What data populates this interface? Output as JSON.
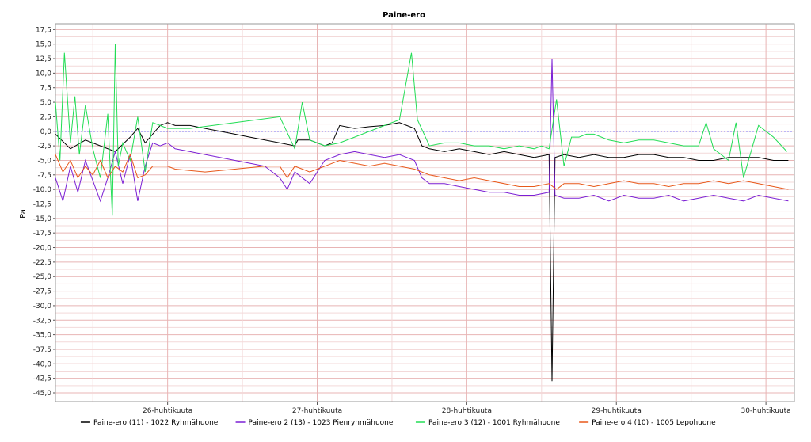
{
  "chart_data": {
    "type": "line",
    "title": "Paine-ero",
    "ylabel": "Pa",
    "xlabel": "",
    "ylim": [
      -46.5,
      18.5
    ],
    "xlim": [
      0,
      4.94
    ],
    "y_ticks": [
      "17,5",
      "15,0",
      "12,5",
      "10,0",
      "7,5",
      "5,0",
      "2,5",
      "0,0",
      "-2,5",
      "-5,0",
      "-7,5",
      "-10,0",
      "-12,5",
      "-15,0",
      "-17,5",
      "-20,0",
      "-22,5",
      "-25,0",
      "-27,5",
      "-30,0",
      "-32,5",
      "-35,0",
      "-37,5",
      "-40,0",
      "-42,5",
      "-45,0"
    ],
    "x_ticks": [
      "26-huhtikuuta",
      "27-huhtikuuta",
      "28-huhtikuuta",
      "29-huhtikuuta",
      "30-huhtikuuta"
    ],
    "reference_line": 0,
    "grid": true,
    "legend_position": "bottom",
    "colors": {
      "plot_border": "#999999",
      "grid_major": "#e8b4b4",
      "grid_minor": "#f3d9d9",
      "reference": "#0000ff"
    },
    "series": [
      {
        "name": "Paine-ero (11) - 1022 Ryhmähuone",
        "color": "#000000",
        "x": [
          0.0,
          0.1,
          0.2,
          0.3,
          0.4,
          0.5,
          0.55,
          0.6,
          0.7,
          0.75,
          0.8,
          0.9,
          1.0,
          1.1,
          1.2,
          1.3,
          1.4,
          1.5,
          1.6,
          1.62,
          1.7,
          1.8,
          1.85,
          1.9,
          2.0,
          2.1,
          2.2,
          2.3,
          2.4,
          2.45,
          2.5,
          2.6,
          2.7,
          2.8,
          2.9,
          3.0,
          3.1,
          3.2,
          3.3,
          3.32,
          3.33,
          3.34,
          3.4,
          3.5,
          3.6,
          3.7,
          3.8,
          3.9,
          4.0,
          4.1,
          4.2,
          4.3,
          4.4,
          4.5,
          4.6,
          4.7,
          4.8,
          4.9
        ],
        "y": [
          -0.5,
          -3.0,
          -1.5,
          -2.5,
          -3.5,
          -1.0,
          0.5,
          -2.0,
          1.0,
          1.5,
          1.0,
          1.0,
          0.5,
          0.0,
          -0.5,
          -1.0,
          -1.5,
          -2.0,
          -2.5,
          -1.5,
          -1.5,
          -2.5,
          -2.0,
          1.0,
          0.5,
          0.8,
          1.0,
          1.5,
          0.5,
          -2.5,
          -3.0,
          -3.5,
          -3.0,
          -3.5,
          -4.0,
          -3.5,
          -4.0,
          -4.5,
          -4.0,
          -43.0,
          -23.5,
          -4.5,
          -4.0,
          -4.5,
          -4.0,
          -4.5,
          -4.5,
          -4.0,
          -4.0,
          -4.5,
          -4.5,
          -5.0,
          -5.0,
          -4.5,
          -4.5,
          -4.5,
          -5.0,
          -5.0
        ]
      },
      {
        "name": "Paine-ero 2 (13) - 1023 Pienryhmähuone",
        "color": "#7b1fd4",
        "x": [
          0.0,
          0.05,
          0.1,
          0.15,
          0.2,
          0.3,
          0.35,
          0.4,
          0.45,
          0.5,
          0.55,
          0.6,
          0.65,
          0.7,
          0.75,
          0.8,
          0.9,
          1.0,
          1.1,
          1.2,
          1.3,
          1.4,
          1.5,
          1.55,
          1.6,
          1.7,
          1.8,
          1.9,
          2.0,
          2.1,
          2.2,
          2.3,
          2.4,
          2.45,
          2.5,
          2.6,
          2.7,
          2.8,
          2.9,
          3.0,
          3.1,
          3.2,
          3.3,
          3.32,
          3.34,
          3.4,
          3.5,
          3.6,
          3.7,
          3.8,
          3.9,
          4.0,
          4.1,
          4.2,
          4.3,
          4.4,
          4.5,
          4.6,
          4.7,
          4.8,
          4.9
        ],
        "y": [
          -8.0,
          -12.0,
          -6.0,
          -10.5,
          -5.0,
          -12.0,
          -8.0,
          -3.5,
          -9.0,
          -4.0,
          -12.0,
          -6.0,
          -2.0,
          -2.5,
          -2.0,
          -3.0,
          -3.5,
          -4.0,
          -4.5,
          -5.0,
          -5.5,
          -6.0,
          -8.0,
          -10.0,
          -7.0,
          -9.0,
          -5.0,
          -4.0,
          -3.5,
          -4.0,
          -4.5,
          -4.0,
          -5.0,
          -8.0,
          -9.0,
          -9.0,
          -9.5,
          -10.0,
          -10.5,
          -10.5,
          -11.0,
          -11.0,
          -10.5,
          12.5,
          -11.0,
          -11.5,
          -11.5,
          -11.0,
          -12.0,
          -11.0,
          -11.5,
          -11.5,
          -11.0,
          -12.0,
          -11.5,
          -11.0,
          -11.5,
          -12.0,
          -11.0,
          -11.5,
          -12.0
        ]
      },
      {
        "name": "Paine-ero 3 (12) - 1001 Ryhmähuone",
        "color": "#22dd55",
        "x": [
          0.0,
          0.03,
          0.06,
          0.1,
          0.13,
          0.16,
          0.2,
          0.25,
          0.3,
          0.35,
          0.38,
          0.4,
          0.42,
          0.45,
          0.5,
          0.55,
          0.6,
          0.65,
          0.7,
          0.75,
          0.8,
          0.85,
          0.9,
          1.2,
          1.5,
          1.6,
          1.65,
          1.7,
          1.75,
          1.8,
          1.9,
          2.0,
          2.2,
          2.3,
          2.38,
          2.42,
          2.5,
          2.6,
          2.7,
          2.8,
          2.9,
          3.0,
          3.1,
          3.2,
          3.25,
          3.3,
          3.35,
          3.4,
          3.45,
          3.5,
          3.55,
          3.6,
          3.7,
          3.8,
          3.9,
          4.0,
          4.1,
          4.2,
          4.3,
          4.35,
          4.4,
          4.5,
          4.55,
          4.6,
          4.7,
          4.8,
          4.89
        ],
        "y": [
          5.0,
          -5.0,
          13.5,
          -2.0,
          6.0,
          -4.0,
          4.5,
          -3.0,
          -8.0,
          3.0,
          -14.5,
          15.0,
          -6.0,
          -2.0,
          -5.0,
          2.5,
          -7.0,
          1.5,
          1.0,
          0.5,
          0.5,
          0.5,
          0.5,
          1.5,
          2.5,
          -3.0,
          5.0,
          -1.5,
          -2.0,
          -2.5,
          -2.0,
          -1.0,
          1.0,
          2.0,
          13.5,
          2.0,
          -2.5,
          -2.0,
          -2.0,
          -2.5,
          -2.5,
          -3.0,
          -2.5,
          -3.0,
          -2.5,
          -3.0,
          5.5,
          -6.0,
          -1.0,
          -1.0,
          -0.5,
          -0.5,
          -1.5,
          -2.0,
          -1.5,
          -1.5,
          -2.0,
          -2.5,
          -2.5,
          1.5,
          -3.0,
          -5.0,
          1.5,
          -8.0,
          1.0,
          -1.0,
          -3.5
        ]
      },
      {
        "name": "Paine-ero 4 (10) - 1005 Lepohuone",
        "color": "#e8581a",
        "x": [
          0.0,
          0.05,
          0.1,
          0.15,
          0.2,
          0.25,
          0.3,
          0.35,
          0.4,
          0.45,
          0.5,
          0.55,
          0.6,
          0.65,
          0.7,
          0.75,
          0.8,
          1.0,
          1.2,
          1.4,
          1.5,
          1.55,
          1.6,
          1.7,
          1.8,
          1.9,
          2.0,
          2.1,
          2.2,
          2.3,
          2.4,
          2.5,
          2.6,
          2.7,
          2.8,
          2.9,
          3.0,
          3.1,
          3.2,
          3.3,
          3.35,
          3.4,
          3.5,
          3.6,
          3.7,
          3.8,
          3.9,
          4.0,
          4.1,
          4.2,
          4.3,
          4.4,
          4.5,
          4.6,
          4.7,
          4.8,
          4.9
        ],
        "y": [
          -4.0,
          -7.0,
          -5.0,
          -8.0,
          -6.0,
          -7.5,
          -5.0,
          -8.0,
          -6.0,
          -7.0,
          -4.0,
          -8.0,
          -7.5,
          -6.0,
          -6.0,
          -6.0,
          -6.5,
          -7.0,
          -6.5,
          -6.0,
          -6.0,
          -8.0,
          -6.0,
          -7.0,
          -6.0,
          -5.0,
          -5.5,
          -6.0,
          -5.5,
          -6.0,
          -6.5,
          -7.5,
          -8.0,
          -8.5,
          -8.0,
          -8.5,
          -9.0,
          -9.5,
          -9.5,
          -9.0,
          -10.0,
          -9.0,
          -9.0,
          -9.5,
          -9.0,
          -8.5,
          -9.0,
          -9.0,
          -9.5,
          -9.0,
          -9.0,
          -8.5,
          -9.0,
          -8.5,
          -9.0,
          -9.5,
          -10.0
        ]
      }
    ]
  }
}
